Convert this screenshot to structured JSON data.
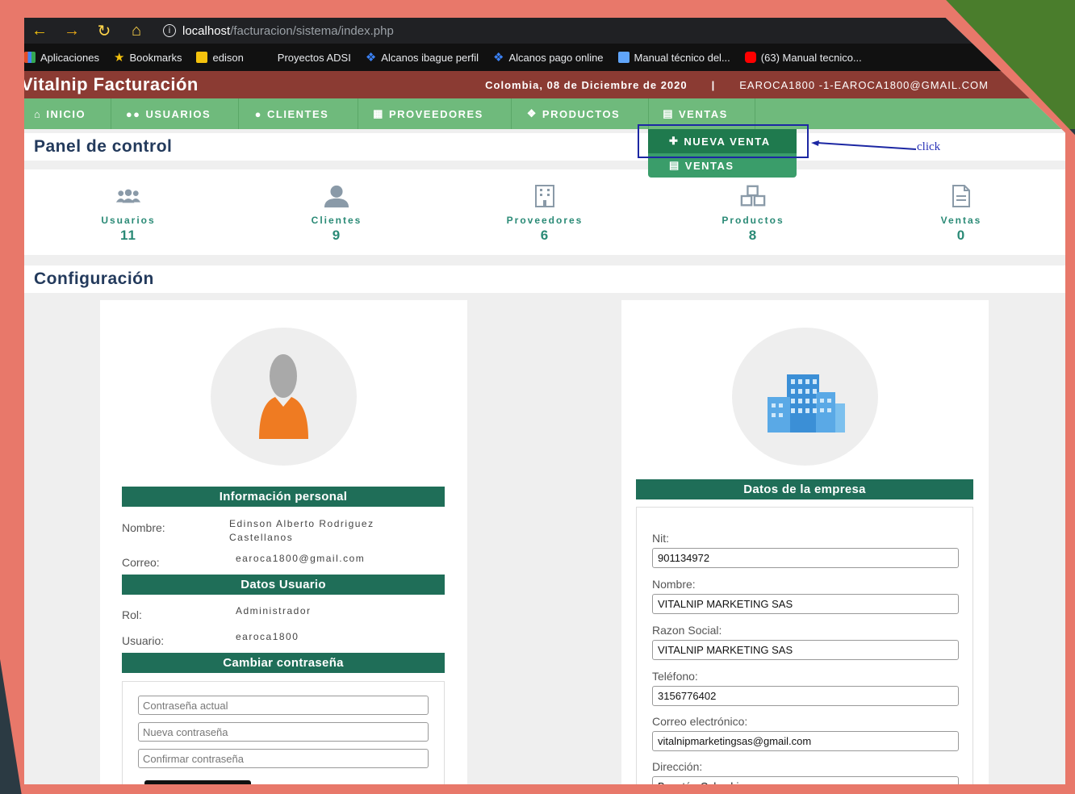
{
  "browser": {
    "url_host": "localhost",
    "url_path": "/facturacion/sistema/index.php",
    "bookmarks": [
      {
        "label": "Aplicaciones",
        "icon": "apps-grid-icon",
        "color": "#e44d26"
      },
      {
        "label": "Bookmarks",
        "icon": "star-icon",
        "color": "#f4c20d"
      },
      {
        "label": "edison",
        "icon": "folder-icon",
        "color": "#f4c20d"
      },
      {
        "label": "Proyectos ADSI",
        "icon": "blank-icon",
        "color": "#111111"
      },
      {
        "label": "Alcanos ibague perfil",
        "icon": "flame-icon",
        "color": "#3b82f6"
      },
      {
        "label": "Alcanos pago online",
        "icon": "flame-icon",
        "color": "#3b82f6"
      },
      {
        "label": "Manual técnico del...",
        "icon": "doc-icon",
        "color": "#60a5fa"
      },
      {
        "label": "(63) Manual tecnico...",
        "icon": "youtube-icon",
        "color": "#ff0000"
      }
    ]
  },
  "header": {
    "title": "Vitalnip Facturación",
    "date": "Colombia, 08 de Diciembre de 2020",
    "separator": "|",
    "user": "EAROCA1800 -1-EAROCA1800@GMAIL.COM"
  },
  "menu": [
    {
      "label": "INICIO",
      "icon": "home-icon"
    },
    {
      "label": "USUARIOS",
      "icon": "users-icon"
    },
    {
      "label": "CLIENTES",
      "icon": "user-icon"
    },
    {
      "label": "PROVEEDORES",
      "icon": "building-icon"
    },
    {
      "label": "PRODUCTOS",
      "icon": "cubes-icon"
    },
    {
      "label": "VENTAS",
      "icon": "file-icon"
    }
  ],
  "dropdown": {
    "new_sale": "NUEVA VENTA",
    "sales": "VENTAS"
  },
  "annotation": {
    "label": "click"
  },
  "panel": {
    "title": "Panel de control",
    "stats": [
      {
        "label": "Usuarios",
        "value": "11"
      },
      {
        "label": "Clientes",
        "value": "9"
      },
      {
        "label": "Proveedores",
        "value": "6"
      },
      {
        "label": "Productos",
        "value": "8"
      },
      {
        "label": "Ventas",
        "value": "0"
      }
    ]
  },
  "config": {
    "title": "Configuración",
    "personal": {
      "heading": "Información personal",
      "name_label": "Nombre:",
      "name_value": "Edinson Alberto Rodriguez Castellanos",
      "email_label": "Correo:",
      "email_value": "earoca1800@gmail.com"
    },
    "user_data": {
      "heading": "Datos Usuario",
      "role_label": "Rol:",
      "role_value": "Administrador",
      "user_label": "Usuario:",
      "user_value": "earoca1800"
    },
    "password": {
      "heading": "Cambiar contraseña",
      "current_placeholder": "Contraseña actual",
      "new_placeholder": "Nueva contraseña",
      "confirm_placeholder": "Confirmar contraseña"
    },
    "company": {
      "heading": "Datos de la empresa",
      "nit_label": "Nit:",
      "nit_value": "901134972",
      "name_label": "Nombre:",
      "name_value": "VITALNIP MARKETING SAS",
      "social_label": "Razon Social:",
      "social_value": "VITALNIP MARKETING SAS",
      "phone_label": "Teléfono:",
      "phone_value": "3156776402",
      "email_label": "Correo electrónico:",
      "email_value": "vitalnipmarketingsas@gmail.com",
      "address_label": "Dirección:",
      "address_value": "Bogotá - Colombia"
    }
  },
  "colors": {
    "header": "#8b3b33",
    "menu": "#6fba7c",
    "accent": "#1f6e58",
    "frame": "#e8786a"
  }
}
